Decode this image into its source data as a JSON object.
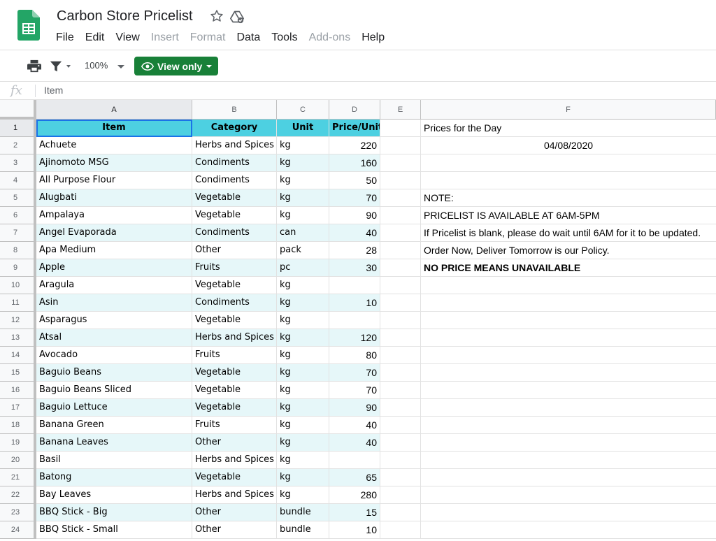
{
  "doc": {
    "title": "Carbon Store Pricelist"
  },
  "menu": [
    {
      "label": "File",
      "disabled": false
    },
    {
      "label": "Edit",
      "disabled": false
    },
    {
      "label": "View",
      "disabled": false
    },
    {
      "label": "Insert",
      "disabled": true
    },
    {
      "label": "Format",
      "disabled": true
    },
    {
      "label": "Data",
      "disabled": false
    },
    {
      "label": "Tools",
      "disabled": false
    },
    {
      "label": "Add-ons",
      "disabled": true
    },
    {
      "label": "Help",
      "disabled": false
    }
  ],
  "toolbar": {
    "zoom": "100%",
    "view_only_label": "View only"
  },
  "formula_bar": {
    "fx": "fx",
    "value": "Item"
  },
  "columns": [
    "A",
    "B",
    "C",
    "D",
    "E",
    "F"
  ],
  "colors": {
    "header_fill": "#4dd0e1",
    "band_fill": "#e6f7f9",
    "view_only_green": "#188038",
    "selection_blue": "#1a73e8"
  },
  "rows": [
    {
      "n": "1",
      "item": "Item",
      "category": "Category",
      "unit": "Unit",
      "price": "Price/Unit",
      "note": "Prices for the Day"
    },
    {
      "n": "2",
      "item": "Achuete",
      "category": "Herbs and Spices",
      "unit": "kg",
      "price": "220",
      "note": "04/08/2020"
    },
    {
      "n": "3",
      "item": "Ajinomoto MSG",
      "category": "Condiments",
      "unit": "kg",
      "price": "160",
      "note": ""
    },
    {
      "n": "4",
      "item": "All Purpose Flour",
      "category": "Condiments",
      "unit": "kg",
      "price": "50",
      "note": ""
    },
    {
      "n": "5",
      "item": "Alugbati",
      "category": "Vegetable",
      "unit": "kg",
      "price": "70",
      "note": "NOTE:"
    },
    {
      "n": "6",
      "item": "Ampalaya",
      "category": "Vegetable",
      "unit": "kg",
      "price": "90",
      "note": "PRICELIST IS AVAILABLE AT 6AM-5PM"
    },
    {
      "n": "7",
      "item": "Angel Evaporada",
      "category": "Condiments",
      "unit": "can",
      "price": "40",
      "note": "If Pricelist is blank, please do wait until 6AM for it to be updated."
    },
    {
      "n": "8",
      "item": "Apa Medium",
      "category": "Other",
      "unit": "pack",
      "price": "28",
      "note": "Order Now, Deliver Tomorrow is our Policy."
    },
    {
      "n": "9",
      "item": "Apple",
      "category": "Fruits",
      "unit": "pc",
      "price": "30",
      "note": "NO PRICE MEANS UNAVAILABLE"
    },
    {
      "n": "10",
      "item": "Aragula",
      "category": "Vegetable",
      "unit": "kg",
      "price": "",
      "note": ""
    },
    {
      "n": "11",
      "item": "Asin",
      "category": "Condiments",
      "unit": "kg",
      "price": "10",
      "note": ""
    },
    {
      "n": "12",
      "item": "Asparagus",
      "category": "Vegetable",
      "unit": "kg",
      "price": "",
      "note": ""
    },
    {
      "n": "13",
      "item": "Atsal",
      "category": "Herbs and Spices",
      "unit": "kg",
      "price": "120",
      "note": ""
    },
    {
      "n": "14",
      "item": "Avocado",
      "category": "Fruits",
      "unit": "kg",
      "price": "80",
      "note": ""
    },
    {
      "n": "15",
      "item": "Baguio Beans",
      "category": "Vegetable",
      "unit": "kg",
      "price": "70",
      "note": ""
    },
    {
      "n": "16",
      "item": "Baguio Beans Sliced",
      "category": "Vegetable",
      "unit": "kg",
      "price": "70",
      "note": ""
    },
    {
      "n": "17",
      "item": "Baguio Lettuce",
      "category": "Vegetable",
      "unit": "kg",
      "price": "90",
      "note": ""
    },
    {
      "n": "18",
      "item": "Banana Green",
      "category": "Fruits",
      "unit": "kg",
      "price": "40",
      "note": ""
    },
    {
      "n": "19",
      "item": "Banana Leaves",
      "category": "Other",
      "unit": "kg",
      "price": "40",
      "note": ""
    },
    {
      "n": "20",
      "item": "Basil",
      "category": "Herbs and Spices",
      "unit": "kg",
      "price": "",
      "note": ""
    },
    {
      "n": "21",
      "item": "Batong",
      "category": "Vegetable",
      "unit": "kg",
      "price": "65",
      "note": ""
    },
    {
      "n": "22",
      "item": "Bay Leaves",
      "category": "Herbs and Spices",
      "unit": "kg",
      "price": "280",
      "note": ""
    },
    {
      "n": "23",
      "item": "BBQ Stick - Big",
      "category": "Other",
      "unit": "bundle",
      "price": "15",
      "note": ""
    },
    {
      "n": "24",
      "item": "BBQ Stick - Small",
      "category": "Other",
      "unit": "bundle",
      "price": "10",
      "note": ""
    }
  ]
}
